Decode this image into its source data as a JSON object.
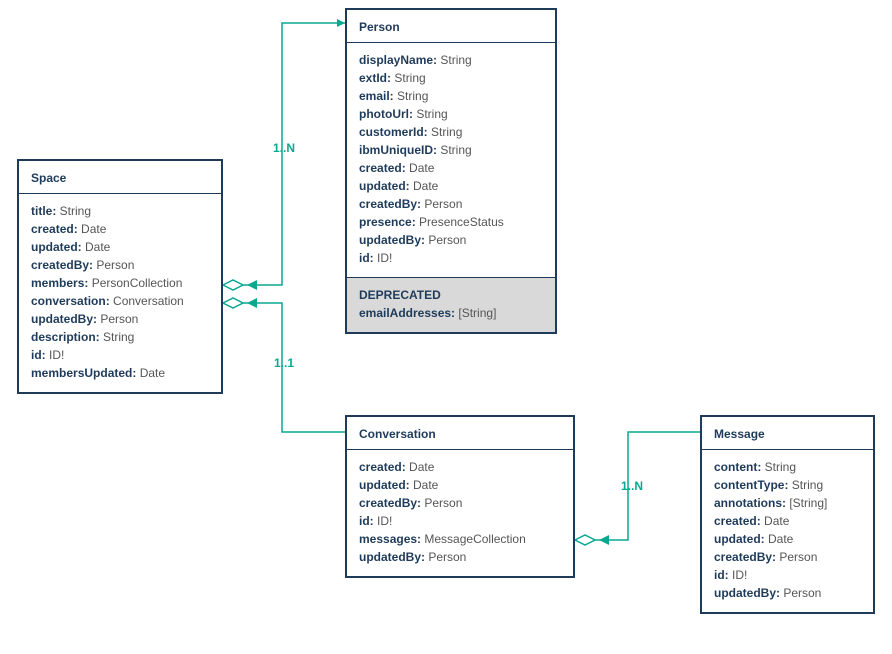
{
  "colors": {
    "border": "#1f3b5a",
    "accent": "#0aa88f",
    "deprecated_bg": "#d9d9d9"
  },
  "entities": {
    "space": {
      "name": "Space",
      "attrs": [
        {
          "name": "title:",
          "type": " String"
        },
        {
          "name": "created:",
          "type": " Date"
        },
        {
          "name": "updated:",
          "type": " Date"
        },
        {
          "name": "createdBy:",
          "type": " Person"
        },
        {
          "name": "members:",
          "type": " PersonCollection"
        },
        {
          "name": "conversation:",
          "type": " Conversation"
        },
        {
          "name": "updatedBy:",
          "type": " Person"
        },
        {
          "name": "description:",
          "type": " String"
        },
        {
          "name": "id:",
          "type": " ID!"
        },
        {
          "name": "membersUpdated:",
          "type": " Date"
        }
      ]
    },
    "person": {
      "name": "Person",
      "attrs": [
        {
          "name": "displayName:",
          "type": " String"
        },
        {
          "name": "extId:",
          "type": " String"
        },
        {
          "name": "email:",
          "type": " String"
        },
        {
          "name": "photoUrl:",
          "type": " String"
        },
        {
          "name": "customerId:",
          "type": " String"
        },
        {
          "name": "ibmUniqueID:",
          "type": " String"
        },
        {
          "name": "created:",
          "type": " Date"
        },
        {
          "name": "updated:",
          "type": " Date"
        },
        {
          "name": "createdBy:",
          "type": " Person"
        },
        {
          "name": "presence:",
          "type": " PresenceStatus"
        },
        {
          "name": "updatedBy:",
          "type": " Person"
        },
        {
          "name": "id:",
          "type": " ID!"
        }
      ],
      "deprecated_label": "DEPRECATED",
      "deprecated_attrs": [
        {
          "name": "emailAddresses:",
          "type": " [String]"
        }
      ]
    },
    "conversation": {
      "name": "Conversation",
      "attrs": [
        {
          "name": "created:",
          "type": " Date"
        },
        {
          "name": "updated:",
          "type": " Date"
        },
        {
          "name": "createdBy:",
          "type": " Person"
        },
        {
          "name": "id:",
          "type": " ID!"
        },
        {
          "name": "messages:",
          "type": " MessageCollection"
        },
        {
          "name": "updatedBy:",
          "type": " Person"
        }
      ]
    },
    "message": {
      "name": "Message",
      "attrs": [
        {
          "name": "content:",
          "type": " String"
        },
        {
          "name": "contentType:",
          "type": " String"
        },
        {
          "name": "annotations:",
          "type": " [String]"
        },
        {
          "name": "created:",
          "type": " Date"
        },
        {
          "name": "updated:",
          "type": " Date"
        },
        {
          "name": "createdBy:",
          "type": " Person"
        },
        {
          "name": "id:",
          "type": " ID!"
        },
        {
          "name": "updatedBy:",
          "type": " Person"
        }
      ]
    }
  },
  "relations": {
    "space_person": "1..N",
    "space_conversation": "1..1",
    "conversation_message": "1..N"
  }
}
